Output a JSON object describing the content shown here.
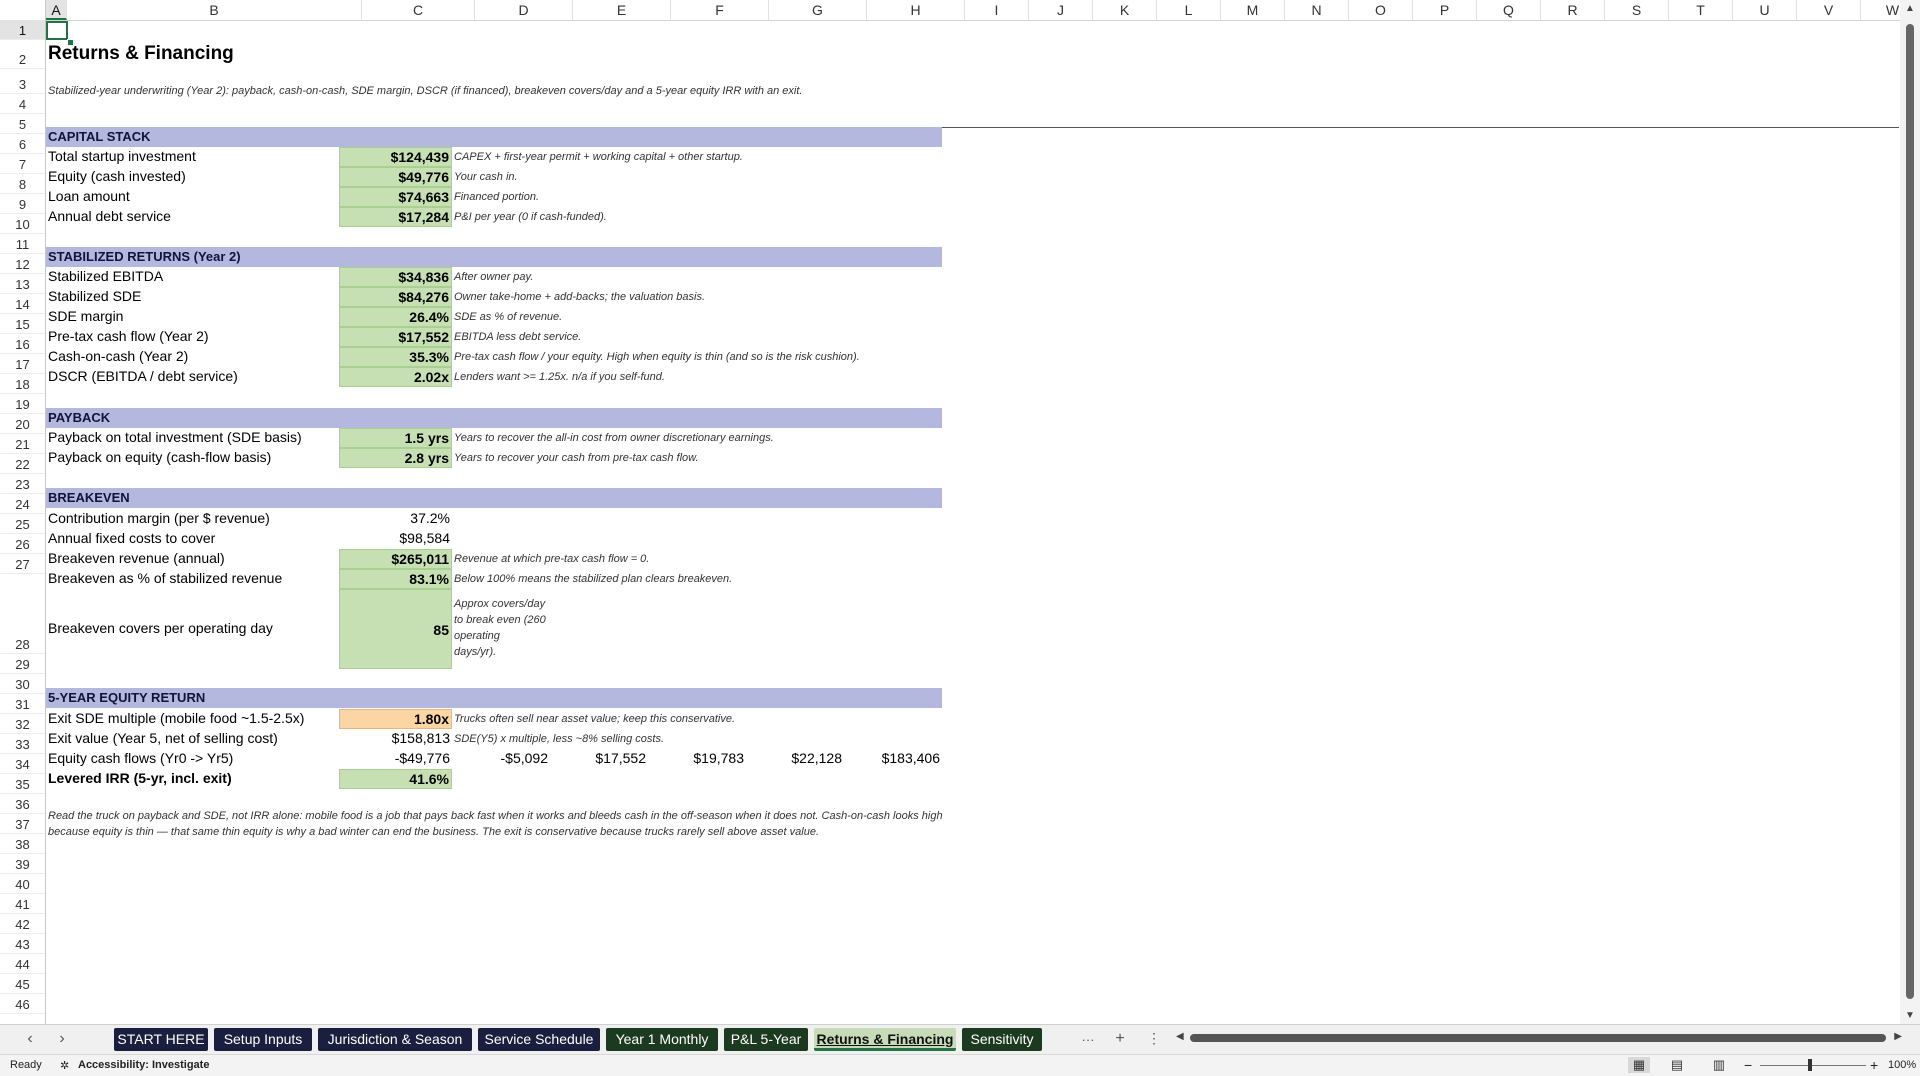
{
  "columns": [
    "A",
    "B",
    "C",
    "D",
    "E",
    "F",
    "G",
    "H",
    "I",
    "J",
    "K",
    "L",
    "M",
    "N",
    "O",
    "P",
    "Q",
    "R",
    "S",
    "T",
    "U",
    "V",
    "W"
  ],
  "rows": [
    "1",
    "2",
    "3",
    "4",
    "5",
    "6",
    "7",
    "8",
    "9",
    "10",
    "11",
    "12",
    "13",
    "14",
    "15",
    "16",
    "17",
    "18",
    "19",
    "20",
    "21",
    "22",
    "23",
    "24",
    "25",
    "26",
    "27",
    "28",
    "29",
    "30",
    "31",
    "32",
    "33",
    "34",
    "35",
    "36",
    "37",
    "38",
    "39",
    "40",
    "41",
    "42",
    "43",
    "44",
    "45",
    "46"
  ],
  "sheet": {
    "title": "Returns & Financing",
    "subtitle": "Stabilized-year underwriting (Year 2): payback, cash-on-cash, SDE margin, DSCR (if financed), breakeven covers/day and a 5-year equity IRR with an exit.",
    "capital": {
      "header": "CAPITAL STACK",
      "rows": [
        {
          "label": "Total startup investment",
          "value": "$124,439",
          "note": "CAPEX + first-year permit + working capital + other startup."
        },
        {
          "label": "Equity (cash invested)",
          "value": "$49,776",
          "note": "Your cash in."
        },
        {
          "label": "Loan amount",
          "value": "$74,663",
          "note": "Financed portion."
        },
        {
          "label": "Annual debt service",
          "value": "$17,284",
          "note": "P&I per year (0 if cash-funded)."
        }
      ]
    },
    "stabilized": {
      "header": "STABILIZED RETURNS (Year 2)",
      "rows": [
        {
          "label": "Stabilized EBITDA",
          "value": "$34,836",
          "note": "After owner pay."
        },
        {
          "label": "Stabilized SDE",
          "value": "$84,276",
          "note": "Owner take-home + add-backs; the valuation basis."
        },
        {
          "label": "SDE margin",
          "value": "26.4%",
          "note": "SDE as % of revenue."
        },
        {
          "label": "Pre-tax cash flow (Year 2)",
          "value": "$17,552",
          "note": "EBITDA less debt service."
        },
        {
          "label": "Cash-on-cash (Year 2)",
          "value": "35.3%",
          "note": "Pre-tax cash flow / your equity. High when equity is thin (and so is the risk cushion)."
        },
        {
          "label": "DSCR (EBITDA / debt service)",
          "value": "2.02x",
          "note": "Lenders want >= 1.25x. n/a if you self-fund."
        }
      ]
    },
    "payback": {
      "header": "PAYBACK",
      "rows": [
        {
          "label": "Payback on total investment (SDE basis)",
          "value": "1.5 yrs",
          "note": "Years to recover the all-in cost from owner discretionary earnings."
        },
        {
          "label": "Payback on equity (cash-flow basis)",
          "value": "2.8 yrs",
          "note": "Years to recover your cash from pre-tax cash flow."
        }
      ]
    },
    "breakeven": {
      "header": "BREAKEVEN",
      "contribution_label": "Contribution margin (per $ revenue)",
      "contribution_value": "37.2%",
      "fixed_label": "Annual fixed costs to cover",
      "fixed_value": "$98,584",
      "revenue_label": "Breakeven revenue (annual)",
      "revenue_value": "$265,011",
      "revenue_note": "Revenue at which pre-tax cash flow = 0.",
      "pct_label": "Breakeven as % of stabilized revenue",
      "pct_value": "83.1%",
      "pct_note": "Below 100% means the stabilized plan clears breakeven.",
      "covers_label": "Breakeven covers per operating day",
      "covers_value": "85",
      "covers_note_1": "Approx covers/day",
      "covers_note_2": "to break even (260",
      "covers_note_3": "operating",
      "covers_note_4": "days/yr)."
    },
    "equity": {
      "header": "5-YEAR EQUITY RETURN",
      "multiple_label": "Exit SDE multiple (mobile food ~1.5-2.5x)",
      "multiple_value": "1.80x",
      "multiple_note": "Trucks often sell near asset value; keep this conservative.",
      "exit_label": "Exit value (Year 5, net of selling cost)",
      "exit_value": "$158,813",
      "exit_note": "SDE(Y5) x multiple, less ~8% selling costs.",
      "flows_label": "Equity cash flows (Yr0 -> Yr5)",
      "flows": [
        "-$49,776",
        "-$5,092",
        "$17,552",
        "$19,783",
        "$22,128",
        "$183,406"
      ],
      "irr_label": "Levered IRR (5-yr, incl. exit)",
      "irr_value": "41.6%"
    },
    "footnote_1": "Read the truck on payback and SDE, not IRR alone: mobile food is a job that pays back fast when it works and bleeds cash in the off-season when it does not. Cash-on-cash looks high",
    "footnote_2": "because equity is thin — that same thin equity is why a bad winter can end the business. The exit is conservative because trucks rarely sell above asset value."
  },
  "tabs": [
    "START HERE",
    "Setup Inputs",
    "Jurisdiction & Season",
    "Service Schedule",
    "Year 1 Monthly",
    "P&L 5-Year",
    "Returns & Financing",
    "Sensitivity"
  ],
  "active_tab": "Returns & Financing",
  "tab_more": "···",
  "tab_add": "+",
  "tab_options": "⋮",
  "status": {
    "ready": "Ready",
    "accessibility": "Accessibility: Investigate",
    "zoom": "100%"
  },
  "colors": {
    "band": "#b4b7de",
    "input_green": "#c6e0b4",
    "input_orange": "#fcd5a4",
    "excel_green": "#217346",
    "tab_navy": "#1b1f3f",
    "tab_dark_green": "#1c3a1f"
  }
}
